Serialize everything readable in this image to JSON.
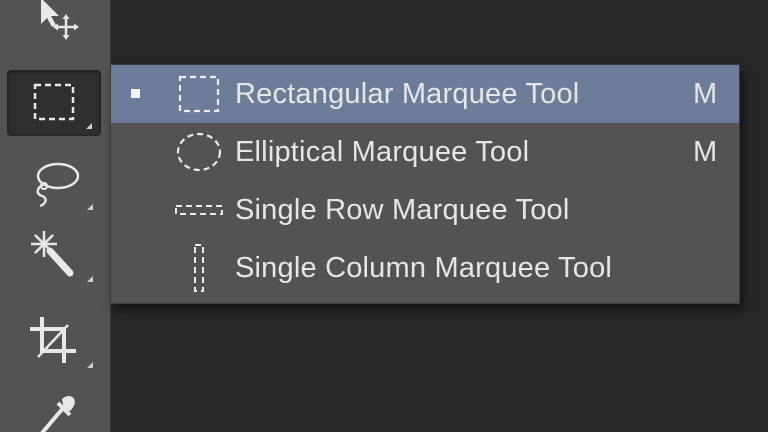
{
  "toolbar": {
    "tools": [
      {
        "name": "move-tool",
        "icon": "move-icon"
      },
      {
        "name": "marquee-tool",
        "icon": "rectangular-marquee-icon",
        "active": true
      },
      {
        "name": "lasso-tool",
        "icon": "lasso-icon"
      },
      {
        "name": "magic-wand-tool",
        "icon": "magic-wand-icon"
      },
      {
        "name": "crop-tool",
        "icon": "crop-icon"
      },
      {
        "name": "eyedropper-tool",
        "icon": "eyedropper-icon"
      }
    ]
  },
  "flyout": {
    "items": [
      {
        "label": "Rectangular Marquee Tool",
        "shortcut": "M",
        "icon": "rectangular-marquee-icon",
        "selected": true
      },
      {
        "label": "Elliptical Marquee Tool",
        "shortcut": "M",
        "icon": "elliptical-marquee-icon",
        "selected": false
      },
      {
        "label": "Single Row Marquee Tool",
        "shortcut": "",
        "icon": "single-row-marquee-icon",
        "selected": false
      },
      {
        "label": "Single Column Marquee Tool",
        "shortcut": "",
        "icon": "single-column-marquee-icon",
        "selected": false
      }
    ]
  },
  "colors": {
    "toolbar_bg": "#535353",
    "menu_bg": "#535353",
    "selection_bg": "#6d7d99",
    "text": "#e6e6e6",
    "background": "#282828"
  }
}
